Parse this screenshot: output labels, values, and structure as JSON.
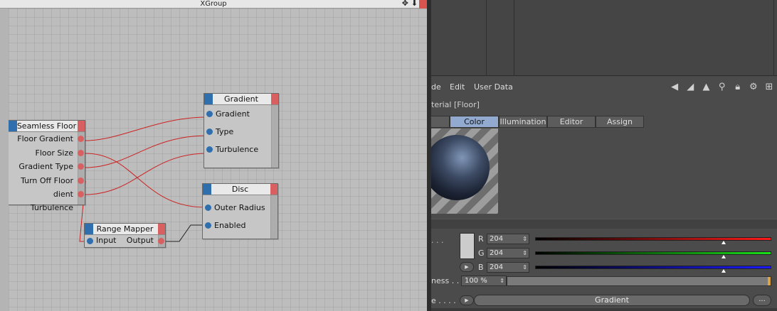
{
  "xgroup": {
    "title": "XGroup",
    "nodes": {
      "seamless_floor": {
        "title": "Seamless Floor",
        "outputs": [
          "Floor Gradient",
          "Floor Size",
          "Gradient Type",
          "Turn Off Floor",
          "dient Turbulence"
        ]
      },
      "gradient": {
        "title": "Gradient",
        "inputs": [
          "Gradient",
          "Type",
          "Turbulence"
        ]
      },
      "disc": {
        "title": "Disc",
        "inputs": [
          "Outer Radius",
          "Enabled"
        ]
      },
      "range_mapper": {
        "title": "Range Mapper",
        "input": "Input",
        "output": "Output"
      }
    }
  },
  "attributes": {
    "menu": [
      "de",
      "Edit",
      "User Data"
    ],
    "material_title": "terial [Floor]",
    "tabs": [
      "Color",
      "Illumination",
      "Editor",
      "Assign"
    ],
    "active_tab": "Color",
    "color": {
      "dots": ". . .",
      "r_label": "R",
      "g_label": "G",
      "b_label": "B",
      "r": "204",
      "g": "204",
      "b": "204",
      "r_level": 0.8,
      "g_level": 0.8,
      "b_level": 0.8
    },
    "brightness": {
      "label": "ness . .",
      "value": "100 %",
      "level": 1.0
    },
    "texture": {
      "label": "e . . . .",
      "value": "Gradient",
      "more": "..."
    }
  }
}
